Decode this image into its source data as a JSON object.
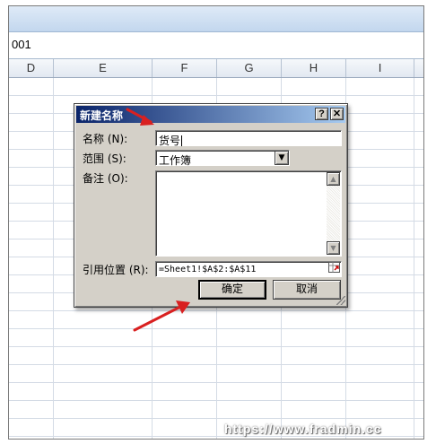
{
  "cell_ref": "001",
  "columns": [
    "D",
    "E",
    "F",
    "G",
    "H",
    "I"
  ],
  "dialog": {
    "title": "新建名称",
    "help_button": "?",
    "close_button": "✕",
    "name_label": "名称 (N):",
    "name_value": "货号",
    "scope_label": "范围 (S):",
    "scope_value": "工作簿",
    "comment_label": "备注 (O):",
    "comment_value": "",
    "refers_label": "引用位置 (R):",
    "refers_value": "=Sheet1!$A$2:$A$11",
    "ok_button": "确定",
    "cancel_button": "取消"
  },
  "watermark": "https://www.fradmin.cc",
  "colors": {
    "titlebar_start": "#0a246a",
    "titlebar_end": "#a6caf0",
    "dialog_bg": "#d4d0c8",
    "arrow": "#d92020"
  },
  "icons": [
    "help-icon",
    "close-icon",
    "dropdown-arrow-icon",
    "scroll-up-icon",
    "scroll-down-icon",
    "range-collapse-icon",
    "red-arrow-icon"
  ]
}
